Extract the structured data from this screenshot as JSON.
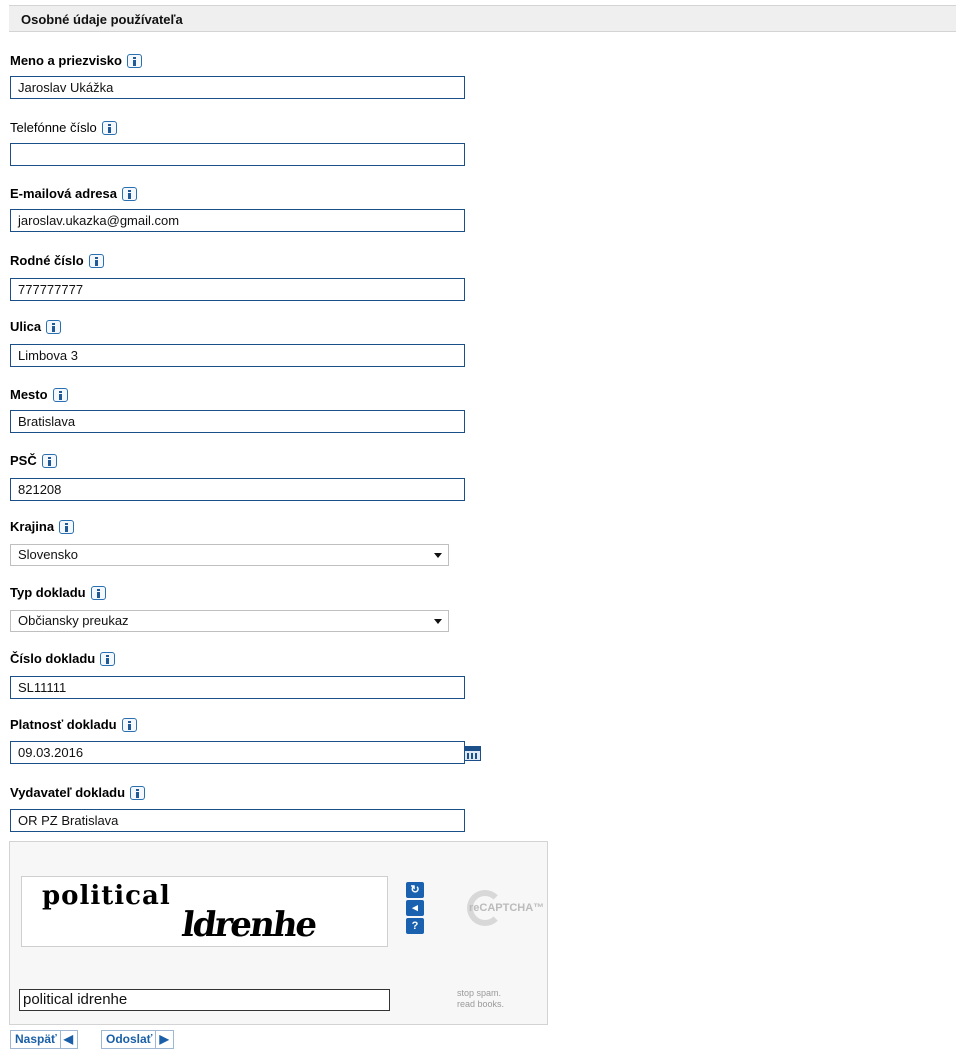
{
  "section_title": "Osobné údaje používateľa",
  "fields": {
    "name": {
      "label": "Meno a priezvisko",
      "value": "Jaroslav Ukážka"
    },
    "phone": {
      "label": "Telefónne číslo",
      "value": ""
    },
    "email": {
      "label": "E-mailová adresa",
      "value": "jaroslav.ukazka@gmail.com"
    },
    "birth_no": {
      "label": "Rodné číslo",
      "value": "777777777"
    },
    "street": {
      "label": "Ulica",
      "value": "Limbova 3"
    },
    "city": {
      "label": "Mesto",
      "value": "Bratislava"
    },
    "zip": {
      "label": "PSČ",
      "value": "821208"
    },
    "country": {
      "label": "Krajina",
      "value": "Slovensko"
    },
    "doc_type": {
      "label": "Typ dokladu",
      "value": "Občiansky preukaz"
    },
    "doc_number": {
      "label": "Číslo dokladu",
      "value": "SL11111"
    },
    "doc_validity": {
      "label": "Platnosť dokladu",
      "value": "09.03.2016"
    },
    "doc_issuer": {
      "label": "Vydavateľ dokladu",
      "value": "OR PZ Bratislava"
    }
  },
  "captcha": {
    "word1": "political",
    "word2": "ldrenhe",
    "response": "political idrenhe",
    "logo_text": "reCAPTCHA™",
    "tagline1": "stop spam.",
    "tagline2": "read books."
  },
  "buttons": {
    "back": "Naspäť",
    "submit": "Odoslať"
  }
}
